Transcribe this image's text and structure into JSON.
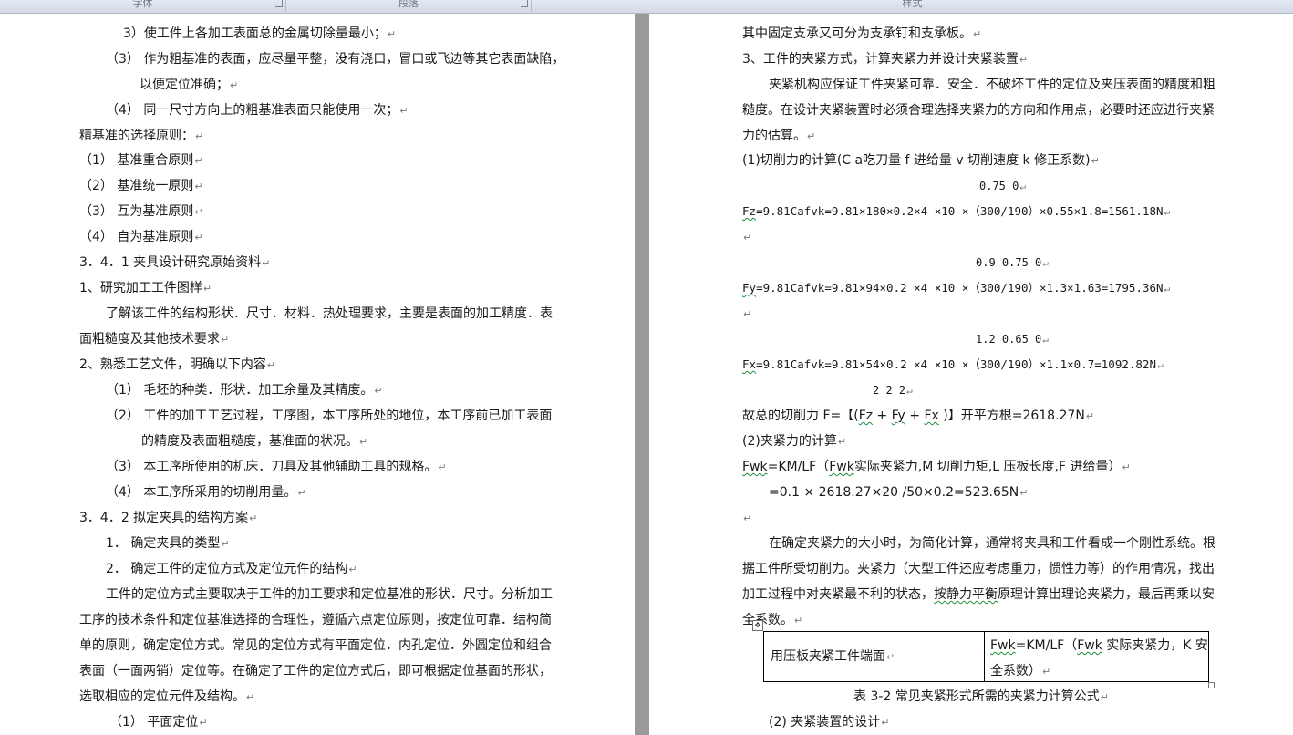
{
  "ribbon": {
    "groups": [
      "字体",
      "段落",
      "样式"
    ]
  },
  "left_page": {
    "lines": [
      "3）使工件上各加工表面总的金属切除量最小；",
      "（3）  作为粗基准的表面，应尽量平整，没有浇口，冒口或飞边等其它表面缺陷，",
      "以便定位准确；",
      "（4）  同一尺寸方向上的粗基准表面只能使用一次；",
      "精基准的选择原则：",
      "（1）  基准重合原则",
      "（2）  基准统一原则",
      "（3）  互为基准原则",
      "（4）  自为基准原则",
      "3．4．1 夹具设计研究原始资料",
      "1、研究加工工件图样",
      "了解该工件的结构形状．尺寸．材料．热处理要求，主要是表面的加工精度．表",
      "面粗糙度及其他技术要求",
      "2、熟悉工艺文件，明确以下内容",
      "（1）  毛坯的种类．形状．加工余量及其精度。",
      "（2）  工件的加工工艺过程，工序图，本工序所处的地位，本工序前已加工表面",
      "的精度及表面粗糙度，基准面的状况。",
      "（3）  本工序所使用的机床．刀具及其他辅助工具的规格。",
      "（4）  本工序所采用的切削用量。",
      "3．4．2 拟定夹具的结构方案",
      "1．  确定夹具的类型",
      "2．  确定工件的定位方式及定位元件的结构",
      "工件的定位方式主要取决于工件的加工要求和定位基准的形状．尺寸。分析加工",
      "工序的技术条件和定位基准选择的合理性，遵循六点定位原则，按定位可靠．结构简",
      "单的原则，确定定位方式。常见的定位方式有平面定位．内孔定位．外圆定位和组合",
      "表面（一面两销）定位等。在确定了工件的定位方式后，即可根据定位基面的形状，",
      "选取相应的定位元件及结构。",
      "（1）  平面定位"
    ]
  },
  "right_page": {
    "lines": [
      "其中固定支承又可分为支承钉和支承板。",
      "3、工件的夹紧方式，计算夹紧力并设计夹紧装置",
      "夹紧机构应保证工件夹紧可靠．安全．不破坏工件的定位及夹压表面的精度和粗",
      "糙度。在设计夹紧装置时必须合理选择夹紧力的方向和作用点，必要时还应进行夹紧",
      "力的估算。",
      "(1)切削力的计算(C  a吃刀量  f 进给量  v 切削速度  k 修正系数)"
    ],
    "fz_exp": "0.75      0",
    "fz_prefix": "Fz",
    "fz_formula": "=9.81Cafvk=9.81×180×0.2×4   ×10 ×（300/190）×0.55×1.8=1561.18N",
    "fy_exp": "0.9     0.75     0",
    "fy_prefix": "Fy",
    "fy_formula": "=9.81Cafvk=9.81×94×0.2   ×4  ×10 ×（300/190）×1.3×1.63=1795.36N",
    "fx_exp": "1.2        0.65     0",
    "fx_prefix": "Fx",
    "fx_formula": "=9.81Cafvk=9.81×54×0.2   ×4  ×10 ×（300/190）×1.1×0.7=1092.82N",
    "squares": "2     2     2",
    "total_a": "故总的切削力 F=【(",
    "total_fz": "Fz",
    "total_b": " +  ",
    "total_fy": "Fy",
    "total_c": " + ",
    "total_fx": "Fx",
    "total_d": " )】开平方根=2618.27N",
    "clamp_title": "(2)夹紧力的计算",
    "fwk_a": "Fwk",
    "fwk_b": "=KM/LF（",
    "fwk_c": "Fwk",
    "fwk_d": "实际夹紧力,M 切削力矩,L 压板长度,F 进给量）",
    "fwk_value": "=0.1  ×  2618.27×20   /50×0.2=523.65N",
    "para2": [
      "在确定夹紧力的大小时，为简化计算，通常将夹具和工件看成一个刚性系统。根",
      "据工件所受切削力。夹紧力（大型工件还应考虑重力，惯性力等）的作用情况，找出",
      "加工过程中对夹紧最不利的状态，",
      "按静力平衡",
      "原理计算出理论夹紧力，最后再乘以安",
      "全系数。"
    ],
    "table": {
      "cell_left": "用压板夹紧工件端面",
      "cell_right_1a": "Fwk",
      "cell_right_1b": "=KM/LF（",
      "cell_right_1c": "Fwk",
      "cell_right_1d": " 实际夹紧力，K 安",
      "cell_right_2": "全系数）"
    },
    "caption": "表 3-2 常见夹紧形式所需的夹紧力计算公式",
    "last_line": "(2) 夹紧装置的设计"
  },
  "paragraph_mark": "↵"
}
